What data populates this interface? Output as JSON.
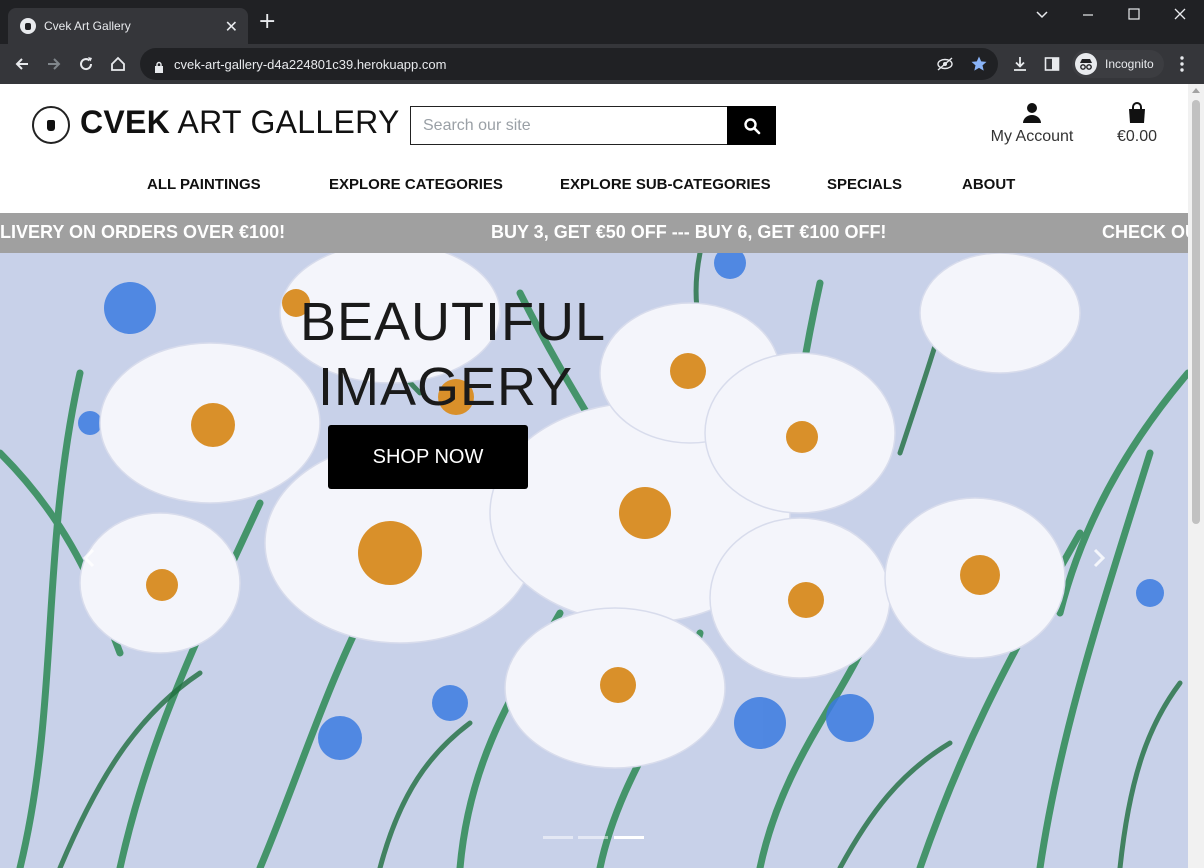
{
  "browser": {
    "tab_title": "Cvek Art Gallery",
    "url": "cvek-art-gallery-d4a224801c39.herokuapp.com",
    "profile_label": "Incognito"
  },
  "header": {
    "title_bold": "CVEK",
    "title_rest": " ART GALLERY",
    "search_placeholder": "Search our site",
    "account_label": "My Account",
    "bag_total": "€0.00"
  },
  "nav": {
    "items": [
      {
        "label": "ALL PAINTINGS"
      },
      {
        "label": "EXPLORE CATEGORIES"
      },
      {
        "label": "EXPLORE SUB-CATEGORIES"
      },
      {
        "label": "SPECIALS"
      },
      {
        "label": "ABOUT"
      }
    ]
  },
  "banner": {
    "messages": [
      "LIVERY ON ORDERS OVER €100!",
      "BUY 3, GET €50 OFF --- BUY 6, GET €100 OFF!",
      "CHECK OU"
    ]
  },
  "hero": {
    "line1": "BEAUTIFUL",
    "line2": "IMAGERY",
    "button_label": "SHOP NOW",
    "slide_count": 3,
    "active_slide": 3
  },
  "colors": {
    "browser_dark": "#202124",
    "browser_toolbar": "#35363a",
    "banner_bg": "#a0a0a0",
    "accent": "#000000",
    "bookmark_star": "#8ab4f8"
  }
}
